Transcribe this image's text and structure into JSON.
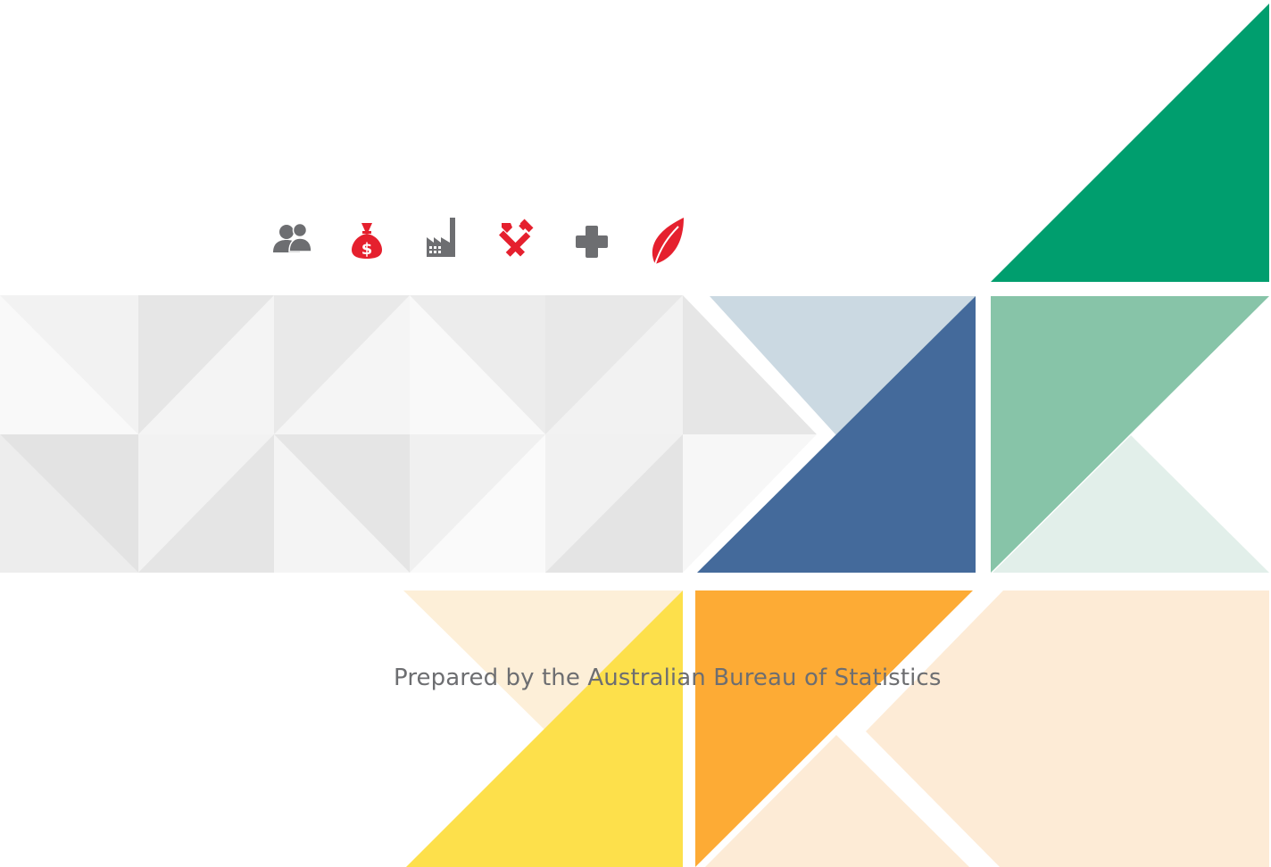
{
  "caption": "Prepared by the Australian Bureau of Statistics",
  "icons": [
    "people-icon",
    "money-bag-icon",
    "factory-icon",
    "tools-icon",
    "health-cross-icon",
    "leaf-icon"
  ],
  "colors": {
    "caption_text": "#6d6e71",
    "icon_grey": "#6d6e71",
    "icon_red": "#e5202e",
    "green_dark": "#009e6e",
    "green_mid": "#87c4a8",
    "green_light": "#e2efea",
    "blue_dark": "#446a9b",
    "blue_light": "#cbd9e2",
    "yellow": "#fde04b",
    "yellow_light": "#fdefd8",
    "orange": "#fdab35",
    "peach": "#fdebd6"
  }
}
